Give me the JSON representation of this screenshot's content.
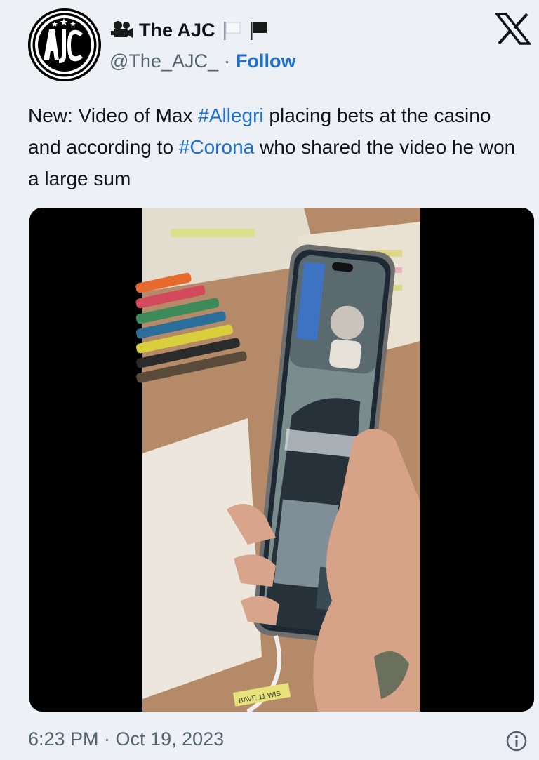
{
  "author": {
    "display_name": "The AJC",
    "handle": "@The_AJC_",
    "separator": "·",
    "follow_label": "Follow",
    "avatar_lettering": "AJC"
  },
  "tweet": {
    "text_1": "New: Video of Max ",
    "hashtag_1": "#Allegri",
    "text_2": " placing bets at the casino and according to ",
    "hashtag_2": "#Corona",
    "text_3": " who shared the video he won a large sum"
  },
  "media": {
    "kind": "video",
    "embedded_text": "BAVE 11 WIS"
  },
  "footer": {
    "timestamp": "6:23 PM · Oct 19, 2023"
  },
  "colors": {
    "link": "#1d6fd2",
    "background": "#edf1f5",
    "text_primary": "#0f1419",
    "text_secondary": "#536471"
  },
  "icons": {
    "name_emojis": [
      "movie-camera-icon",
      "white-flag-icon",
      "black-flag-icon"
    ],
    "brand": "x-logo-icon",
    "info": "info-icon"
  }
}
